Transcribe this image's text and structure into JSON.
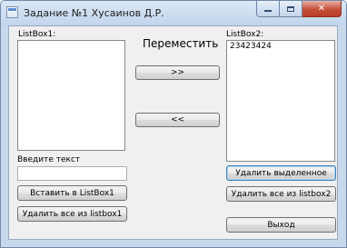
{
  "window": {
    "title": "Задание №1 Хусаинов Д.Р.",
    "close_glyph": "✕"
  },
  "form": {
    "listbox1_label": "ListBox1:",
    "listbox2_label": "ListBox2:",
    "move_label": "Переместить",
    "move_right_button": ">>",
    "move_left_button": "<<",
    "input_label": "Введите текст",
    "input_value": "",
    "insert_button": "Вставить в ListBox1",
    "clear_listbox1_button": "Удалить все из listbox1",
    "delete_selected_button": "Удалить выделенное",
    "clear_listbox2_button": "Удалить все из listbox2",
    "exit_button": "Выход",
    "listbox1_items": [],
    "listbox2_items": [
      "23423424"
    ]
  },
  "colors": {
    "titlebar": "#c9d9ec",
    "client_background": "#f0f0f0",
    "close_button": "#c7503b"
  }
}
